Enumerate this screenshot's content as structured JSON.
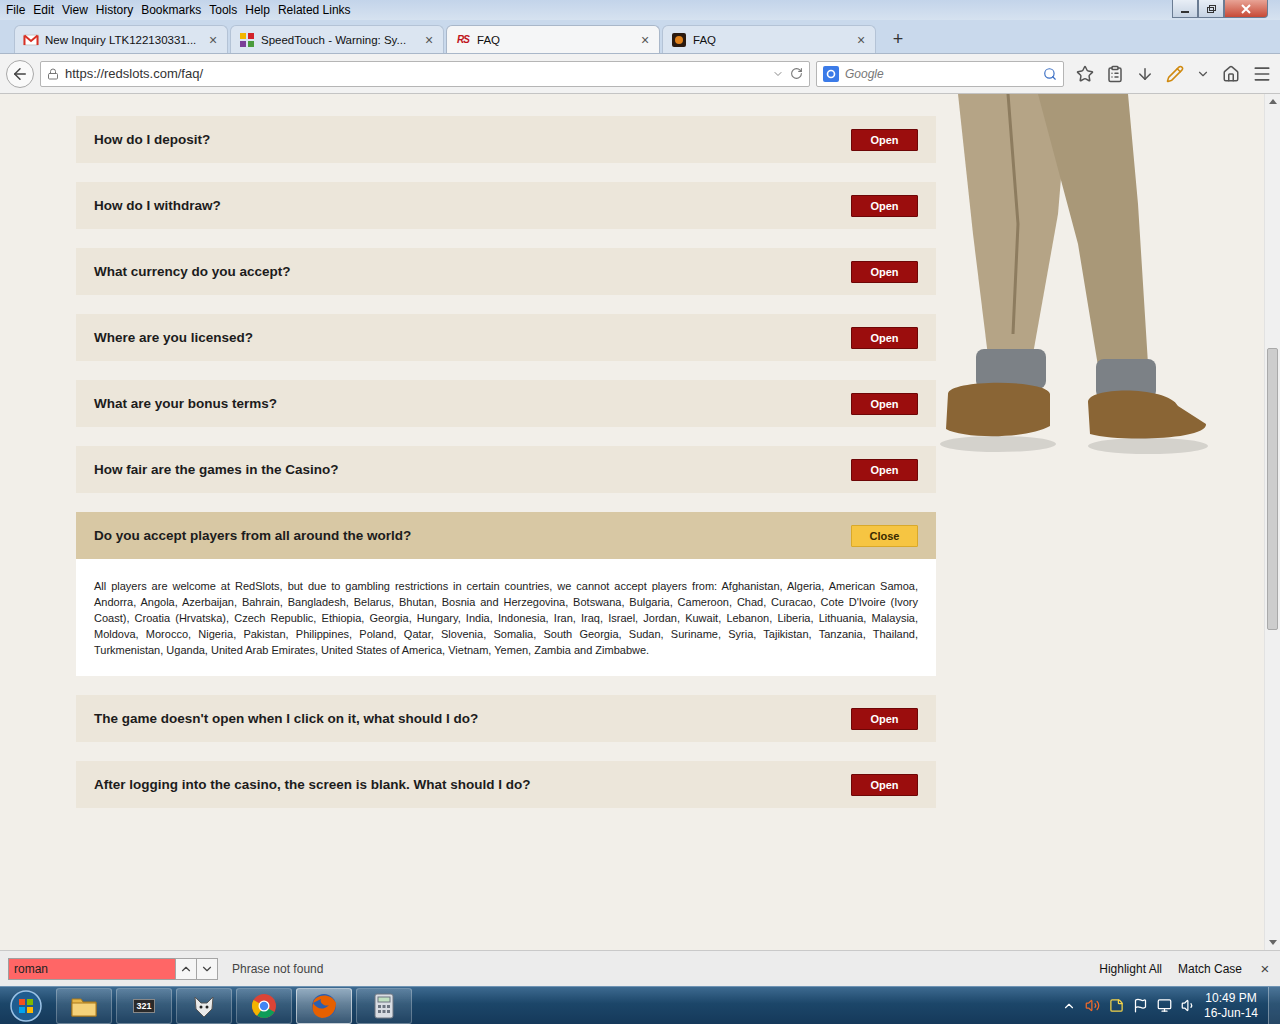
{
  "menu": [
    "File",
    "Edit",
    "View",
    "History",
    "Bookmarks",
    "Tools",
    "Help",
    "Related Links"
  ],
  "tabs": [
    {
      "label": "New Inquiry LTK122130331...",
      "selected": false,
      "kind": "gmail",
      "badge": ""
    },
    {
      "label": "SpeedTouch - Warning: Sy...",
      "selected": false,
      "kind": "speedtouch",
      "badge": ""
    },
    {
      "label": "FAQ",
      "selected": true,
      "kind": "redslots",
      "badge": "RS"
    },
    {
      "label": "FAQ",
      "selected": false,
      "kind": "game",
      "badge": ""
    }
  ],
  "tab_close": "×",
  "new_tab": "+",
  "address": {
    "url": "https://redslots.com/faq/"
  },
  "search": {
    "placeholder": "Google"
  },
  "faq": [
    {
      "question": "How do I deposit?",
      "button": "Open",
      "expanded": false,
      "answer": ""
    },
    {
      "question": "How do I withdraw?",
      "button": "Open",
      "expanded": false,
      "answer": ""
    },
    {
      "question": "What currency do you accept?",
      "button": "Open",
      "expanded": false,
      "answer": ""
    },
    {
      "question": "Where are you licensed?",
      "button": "Open",
      "expanded": false,
      "answer": ""
    },
    {
      "question": "What are your bonus terms?",
      "button": "Open",
      "expanded": false,
      "answer": ""
    },
    {
      "question": "How fair are the games in the Casino?",
      "button": "Open",
      "expanded": false,
      "answer": ""
    },
    {
      "question": "Do you accept players from all around the world?",
      "button": "Close",
      "expanded": true,
      "answer": "All players are welcome at RedSlots, but due to gambling restrictions in certain countries, we cannot accept players from: Afghanistan, Algeria, American Samoa, Andorra, Angola, Azerbaijan, Bahrain, Bangladesh, Belarus, Bhutan, Bosnia and Herzegovina, Botswana, Bulgaria, Cameroon, Chad, Curacao, Cote D'Ivoire (Ivory Coast), Croatia (Hrvatska), Czech Republic, Ethiopia, Georgia, Hungary, India, Indonesia, Iran, Iraq, Israel, Jordan, Kuwait, Lebanon, Liberia, Lithuania, Malaysia, Moldova, Morocco, Nigeria, Pakistan, Philippines, Poland, Qatar, Slovenia, Somalia, South Georgia, Sudan, Suriname, Syria, Tajikistan, Tanzania, Thailand, Turkmenistan, Uganda, United Arab Emirates, United States of America, Vietnam, Yemen, Zambia and Zimbabwe."
    },
    {
      "question": "The game doesn't open when I click on it, what should I do?",
      "button": "Open",
      "expanded": false,
      "answer": ""
    },
    {
      "question": "After logging into the casino, the screen is blank. What should I do?",
      "button": "Open",
      "expanded": false,
      "answer": ""
    }
  ],
  "scrollbar": {
    "start": 0.29,
    "size": 0.34
  },
  "find_bar": {
    "query": "roman",
    "found": false,
    "status": "Phrase not found",
    "options": [
      "Highlight All",
      "Match Case"
    ],
    "close": "×"
  },
  "taskbar": {
    "apps": [
      {
        "kind": "explorer",
        "badge": "",
        "active": false
      },
      {
        "kind": "player",
        "badge": "321",
        "active": false
      },
      {
        "kind": "fox",
        "badge": "",
        "active": false
      },
      {
        "kind": "chrome",
        "badge": "",
        "active": false
      },
      {
        "kind": "firefox",
        "badge": "",
        "active": true
      },
      {
        "kind": "calculator",
        "badge": "",
        "active": false
      }
    ],
    "time": "10:49 PM",
    "date": "16-Jun-14"
  }
}
